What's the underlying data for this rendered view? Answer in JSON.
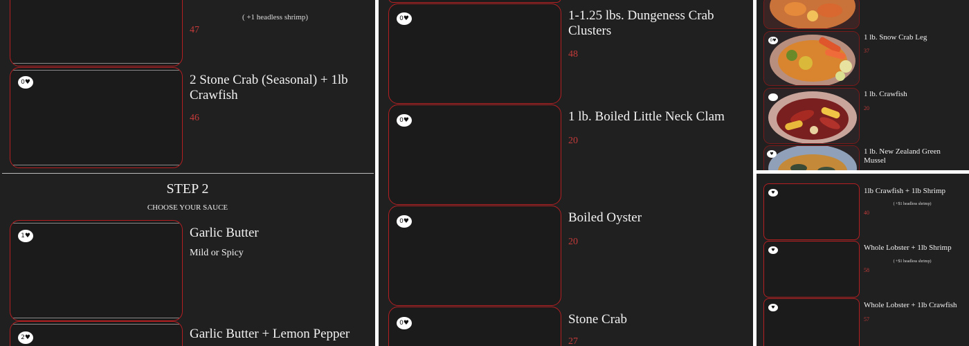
{
  "panel1": {
    "top_item": {
      "note": "( +1 headless shrimp)",
      "price": "47",
      "likes": ""
    },
    "items": [
      {
        "name": "2 Stone Crab (Seasonal) + 1lb Crawfish",
        "price": "46",
        "likes": "0♥"
      }
    ],
    "step": {
      "title": "STEP 2",
      "subtitle": "CHOOSE YOUR SAUCE"
    },
    "sauces": [
      {
        "name": "Garlic Butter",
        "desc": "Mild or Spicy",
        "likes": "1♥"
      },
      {
        "name": "Garlic Butter + Lemon Pepper",
        "likes": "2♥"
      }
    ]
  },
  "panel2": {
    "items": [
      {
        "name": "1-1.25 lbs. Dungeness Crab Clusters",
        "price": "48",
        "likes": "0♥"
      },
      {
        "name": "1 lb. Boiled Little Neck Clam",
        "price": "20",
        "likes": "0♥"
      },
      {
        "name": "Boiled Oyster",
        "price": "20",
        "likes": "0♥"
      },
      {
        "name": "Stone Crab",
        "price": "27",
        "likes": "0♥"
      }
    ]
  },
  "panel3a": {
    "items": [
      {
        "name": "1 lb. Snow Crab Leg",
        "price": "37",
        "likes": "0♥"
      },
      {
        "name": "1 lb. Crawfish",
        "price": "20",
        "likes": ""
      },
      {
        "name": "1 lb. New Zealand Green Mussel",
        "likes": "♥"
      }
    ]
  },
  "panel3b": {
    "items": [
      {
        "name": "1lb Crawfish + 1lb Shrimp",
        "note": "( +$1 headless shrimp)",
        "price": "40",
        "likes": "♥"
      },
      {
        "name": "Whole Lobster + 1lb Shrimp",
        "note": "( +$1 headless shrimp)",
        "price": "58",
        "likes": "♥"
      },
      {
        "name": "Whole Lobster + 1lb Crawfish",
        "price": "57",
        "likes": "♥"
      }
    ]
  },
  "colors": {
    "background": "#202020",
    "accent": "#b51f22",
    "price": "#c53a3a"
  }
}
